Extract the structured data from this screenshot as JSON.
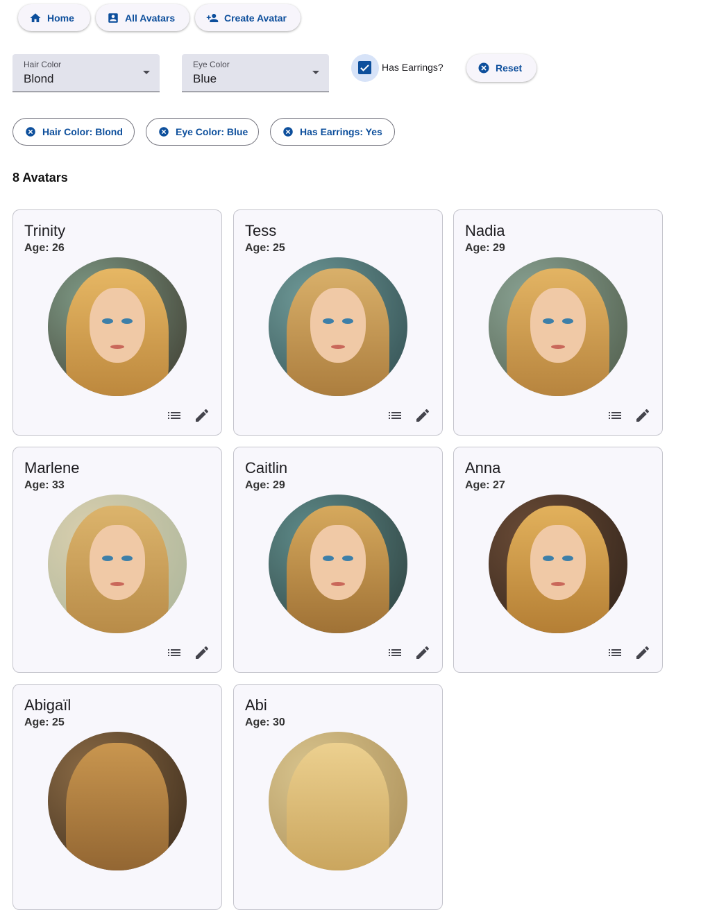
{
  "nav": {
    "home_label": "Home",
    "all_avatars_label": "All Avatars",
    "create_avatar_label": "Create Avatar"
  },
  "filters": {
    "hair_color": {
      "label": "Hair Color",
      "value": "Blond"
    },
    "eye_color": {
      "label": "Eye Color",
      "value": "Blue"
    },
    "has_earrings": {
      "label": "Has Earrings?",
      "checked": true
    },
    "reset_label": "Reset"
  },
  "chips": [
    {
      "label": "Hair Color: Blond"
    },
    {
      "label": "Eye Color: Blue"
    },
    {
      "label": "Has Earrings: Yes"
    }
  ],
  "results": {
    "count_label": "8 Avatars"
  },
  "avatars": [
    {
      "name": "Trinity",
      "age": "Age: 26"
    },
    {
      "name": "Tess",
      "age": "Age: 25"
    },
    {
      "name": "Nadia",
      "age": "Age: 29"
    },
    {
      "name": "Marlene",
      "age": "Age: 33"
    },
    {
      "name": "Caitlin",
      "age": "Age: 29"
    },
    {
      "name": "Anna",
      "age": "Age: 27"
    },
    {
      "name": "Abigaïl",
      "age": "Age: 25"
    },
    {
      "name": "Abi",
      "age": "Age: 30"
    }
  ],
  "colors": {
    "primary": "#0d4f9c",
    "select_bg": "#e2e3ec",
    "card_bg": "#f8f7fc",
    "card_border": "#c4c4cc",
    "checkbox_halo": "#d7e3f8"
  },
  "icons": {
    "home": "home-icon",
    "all_avatars": "account-box-icon",
    "create_avatar": "person-add-icon",
    "reset": "cancel-icon",
    "chip": "cancel-icon",
    "card_list": "list-icon",
    "card_edit": "pencil-icon"
  }
}
